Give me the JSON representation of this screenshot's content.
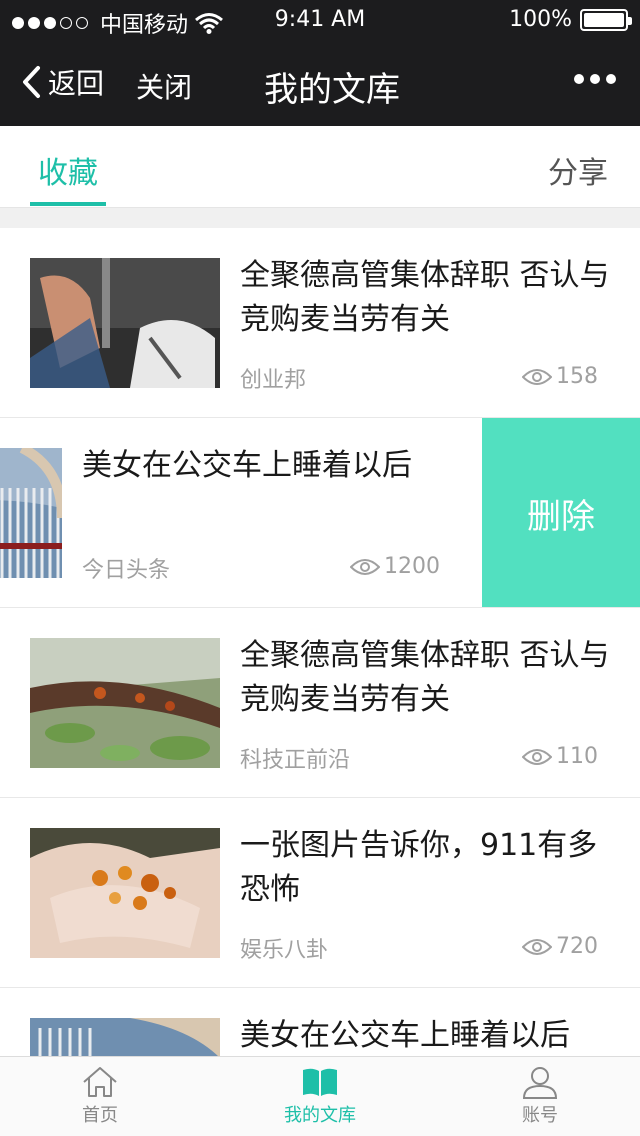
{
  "status_bar": {
    "carrier": "中国移动",
    "time": "9:41 AM",
    "battery": "100%",
    "battery_level": 1.0
  },
  "nav": {
    "back_label": "返回",
    "close_label": "关闭",
    "title": "我的文库"
  },
  "tabs": {
    "favorites": "收藏",
    "share": "分享"
  },
  "items": [
    {
      "title": "全聚德高管集体辞职 否认与竞购麦当劳有关",
      "source": "创业邦",
      "views": "158"
    },
    {
      "title": "美女在公交车上睡着以后",
      "source": "今日头条",
      "views": "1200",
      "action": "删除"
    },
    {
      "title": "全聚德高管集体辞职 否认与竞购麦当劳有关",
      "source": "科技正前沿",
      "views": "110"
    },
    {
      "title": "一张图片告诉你，911有多恐怖",
      "source": "娱乐八卦",
      "views": "720"
    },
    {
      "title": "美女在公交车上睡着以后",
      "source": "",
      "views": ""
    }
  ],
  "tab_bar": {
    "home": "首页",
    "library": "我的文库",
    "account": "账号"
  },
  "colors": {
    "accent": "#1ebfa8",
    "delete_bg": "#52e0c0",
    "bar_bg": "#1c1c1e"
  }
}
